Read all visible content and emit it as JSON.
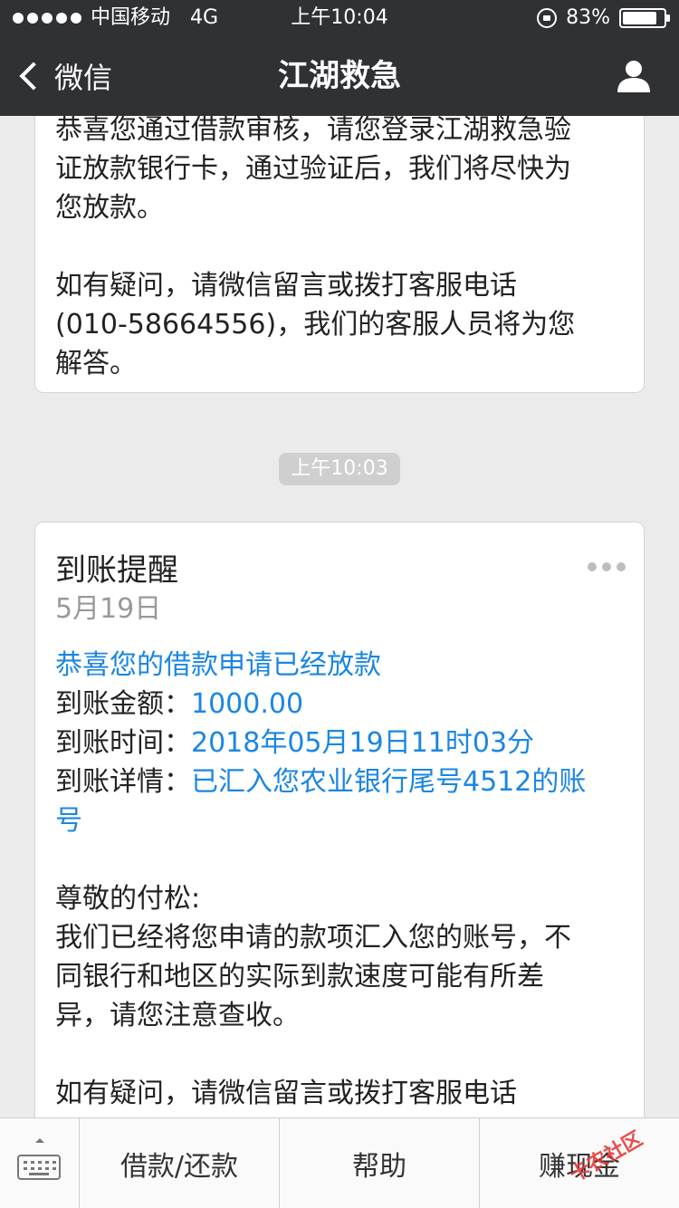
{
  "status": {
    "carrier": "中国移动",
    "network": "4G",
    "time": "上午10:04",
    "battery": "83%",
    "battery_level": 0.83
  },
  "nav": {
    "back_label": "微信",
    "title": "江湖救急"
  },
  "message1": {
    "lines": [
      "恭喜您通过借款审核，请您登录江湖救急验",
      "证放款银行卡，通过验证后，我们将尽快为",
      "您放款。",
      "如有疑问，请微信留言或拨打客服电话",
      "(010-58664556)，我们的客服人员将为您",
      "解答。"
    ]
  },
  "timestamp": "上午10:03",
  "message2": {
    "title": "到账提醒",
    "date": "5月19日",
    "headline": "恭喜您的借款申请已经放款",
    "amount_label": "到账金额：",
    "amount_value": "1000.00",
    "time_label": "到账时间：",
    "time_value": "2018年05月19日11时03分",
    "detail_label": "到账详情：",
    "detail_value_line1": "已汇入您农业银行尾号4512的账",
    "detail_value_line2": "号",
    "greeting": "尊敬的付松:",
    "body_lines": [
      "我们已经将您申请的款项汇入您的账号，不",
      "同银行和地区的实际到款速度可能有所差",
      "异，请您注意查收。"
    ],
    "footer": "如有疑问，请微信留言或拨打客服电话"
  },
  "menu": {
    "items": [
      "借款/还款",
      "帮助",
      "赚现金"
    ]
  },
  "watermark": "卡农社区",
  "colors": {
    "nav_bg": "#2f3135",
    "link_blue": "#1b86e3",
    "chat_bg": "#ebebeb"
  }
}
